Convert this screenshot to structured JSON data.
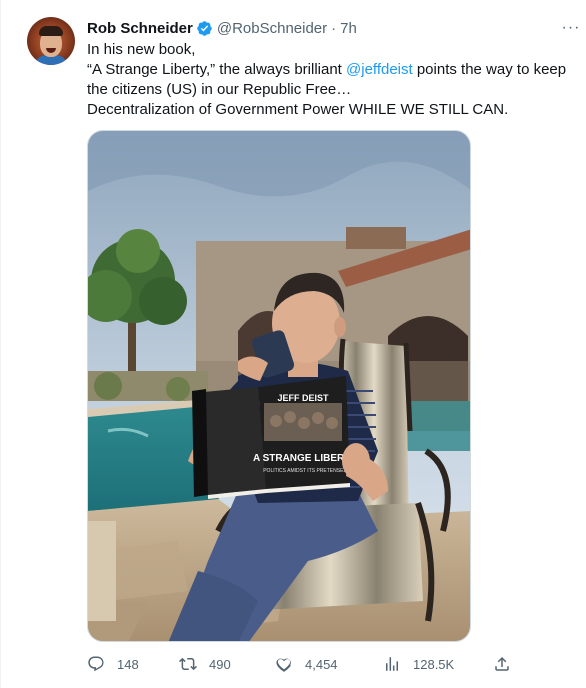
{
  "tweet": {
    "author_name": "Rob Schneider",
    "handle": "@RobSchneider",
    "separator": "·",
    "time": "7h",
    "more": "···",
    "lines": {
      "line1": "In his new book,",
      "line2_pre": "“A Strange Liberty,” the always brilliant ",
      "mention": "@jeffdeist",
      "line2_post": " points the way to keep the citizens (US) in our Republic Free…",
      "line3": "Decentralization of Government Power WHILE WE STILL CAN."
    },
    "book_cover": {
      "author": "JEFF DEIST",
      "title": "A STRANGE LIBERTY",
      "subtitle": "POLITICS AMIDST ITS PRETENSES"
    }
  },
  "actions": {
    "replies": "148",
    "retweets": "490",
    "likes": "4,454",
    "views": "128.5K"
  },
  "colors": {
    "accent": "#1d9bf0",
    "secondary_text": "#536471",
    "primary_text": "#0f1419"
  }
}
